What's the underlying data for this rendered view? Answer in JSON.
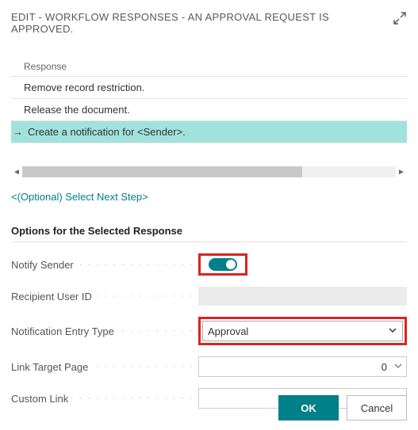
{
  "header": {
    "title": "EDIT - WORKFLOW RESPONSES - AN APPROVAL REQUEST IS APPROVED."
  },
  "section": {
    "label": "Response"
  },
  "responses": {
    "items": [
      {
        "text": "Remove record restriction."
      },
      {
        "text": "Release the document."
      },
      {
        "text": "Create a notification for <Sender>."
      }
    ]
  },
  "links": {
    "select_next_step": "<(Optional) Select Next Step>"
  },
  "options": {
    "title": "Options for the Selected Response",
    "notify_sender_label": "Notify Sender",
    "recipient_user_id_label": "Recipient User ID",
    "recipient_user_id_value": "",
    "notification_entry_type_label": "Notification Entry Type",
    "notification_entry_type_value": "Approval",
    "link_target_page_label": "Link Target Page",
    "link_target_page_value": "0",
    "custom_link_label": "Custom Link",
    "custom_link_value": ""
  },
  "footer": {
    "ok": "OK",
    "cancel": "Cancel"
  },
  "highlights": {
    "notify_sender": true,
    "notification_entry_type": true
  }
}
